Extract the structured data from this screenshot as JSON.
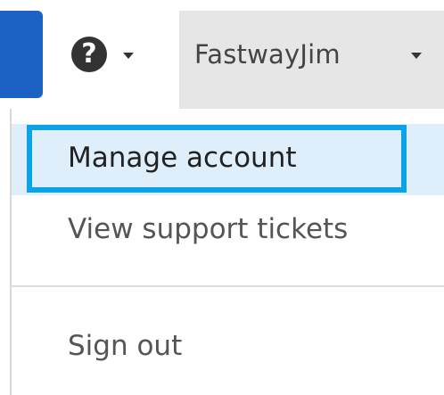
{
  "header": {
    "help_icon_glyph": "?",
    "help_icon": "question-circle-icon",
    "username": "FastwayJim"
  },
  "user_menu": {
    "items": [
      {
        "label": "Manage account",
        "state": "focused"
      },
      {
        "label": "View support tickets"
      },
      {
        "label": "Sign out"
      }
    ]
  },
  "colors": {
    "primary_blue": "#1b62c4",
    "user_menu_bg": "#e6e6e6",
    "highlight_bg": "#deeefb",
    "focus_ring": "#0aa3e8",
    "divider": "#dcdcdc"
  }
}
